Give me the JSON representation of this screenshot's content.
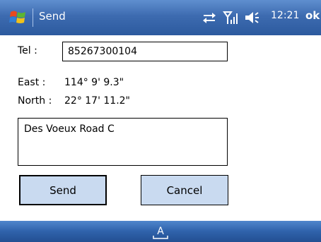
{
  "window": {
    "title": "Send",
    "clock": "12:21",
    "ok_label": "ok",
    "status_icons": [
      "connectivity-icon",
      "signal-strength-icon",
      "volume-icon"
    ]
  },
  "form": {
    "tel_label": "Tel :",
    "tel_value": "85267300104",
    "east_label": "East :",
    "east_value": "114° 9' 9.3\"",
    "north_label": "North :",
    "north_value": "22° 17' 11.2\"",
    "address_value": "Des Voeux Road C"
  },
  "buttons": {
    "send_label": "Send",
    "cancel_label": "Cancel"
  },
  "bottombar": {
    "input_icon": "keyboard-icon",
    "input_label": "A"
  },
  "colors": {
    "titlebar": "#3d6bb0",
    "button_fill": "#c9daf0",
    "bottombar": "#2f62ab"
  }
}
